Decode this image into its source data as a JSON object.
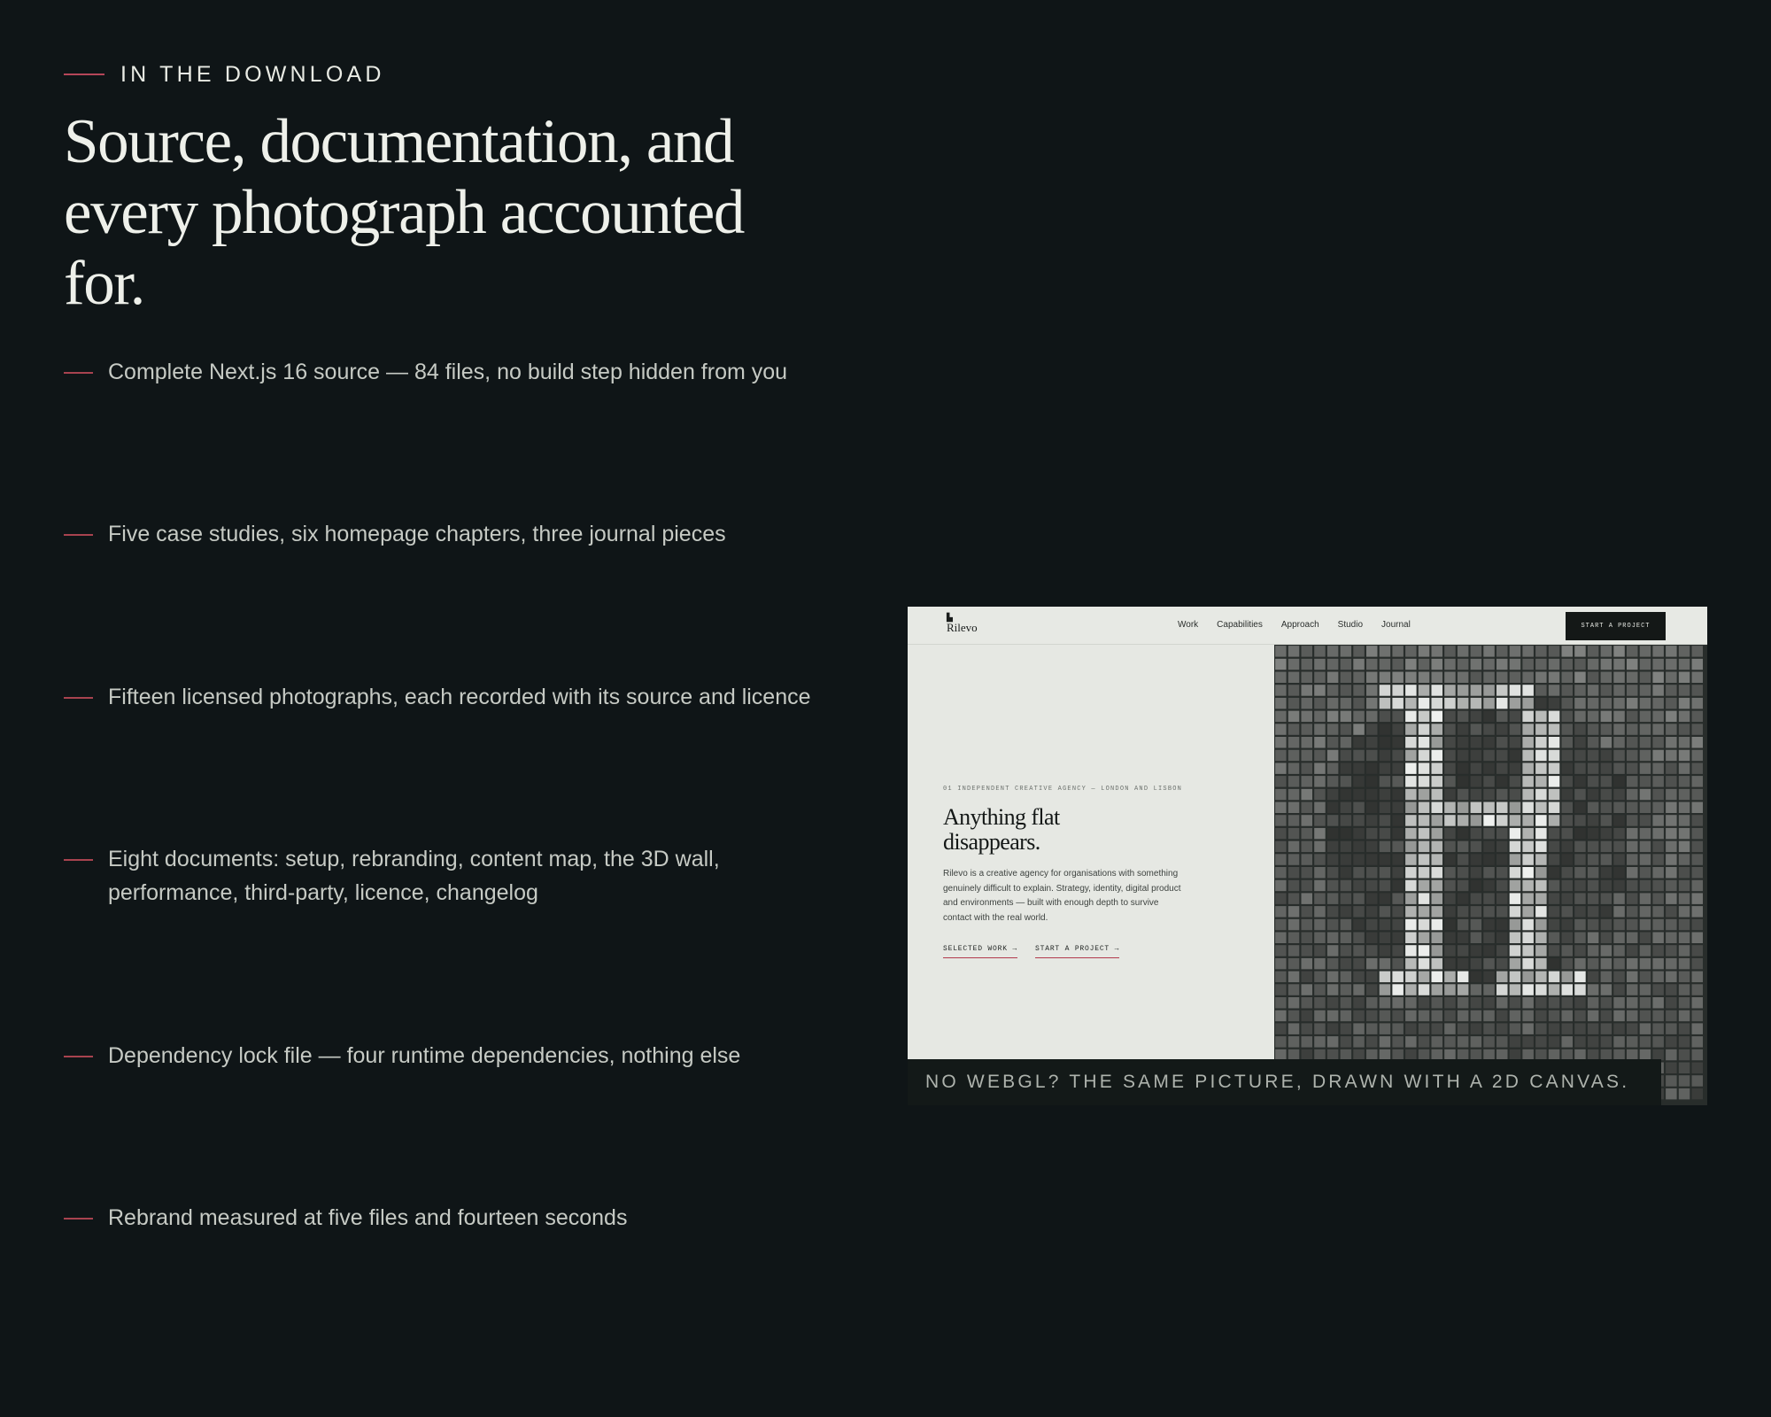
{
  "section": {
    "eyebrow": "IN THE DOWNLOAD",
    "headline": "Source, documentation, and every photograph accounted for.",
    "accent_color": "#b54659"
  },
  "features": [
    {
      "text": "Complete Next.js 16 source — 84 files, no build step hidden from you"
    },
    {
      "text": "Five case studies, six homepage chapters, three journal pieces"
    },
    {
      "text": "Fifteen licensed photographs, each recorded with its source and licence"
    },
    {
      "text": "Eight documents: setup, rebranding, content map, the 3D wall, performance, third-party, licence, changelog"
    },
    {
      "text": "Dependency lock file — four runtime dependencies, nothing else"
    },
    {
      "text": "Rebrand measured at five files and fourteen seconds"
    }
  ],
  "preview": {
    "logo": "Rilevo",
    "nav_links": [
      "Work",
      "Capabilities",
      "Approach",
      "Studio",
      "Journal"
    ],
    "cta": "START A PROJECT",
    "eyebrow": "01  INDEPENDENT CREATIVE AGENCY — LONDON AND LISBON",
    "title": "Anything flat disappears.",
    "body": "Rilevo is a creative agency for organisations with something genuinely difficult to explain. Strategy, identity, digital product and environments — built with enough depth to survive contact with the real world.",
    "links": [
      "SELECTED WORK →",
      "START A PROJECT →"
    ],
    "grid_letter": "R",
    "caption": "NO WEBGL? THE SAME PICTURE, DRAWN WITH A 2D CANVAS."
  }
}
